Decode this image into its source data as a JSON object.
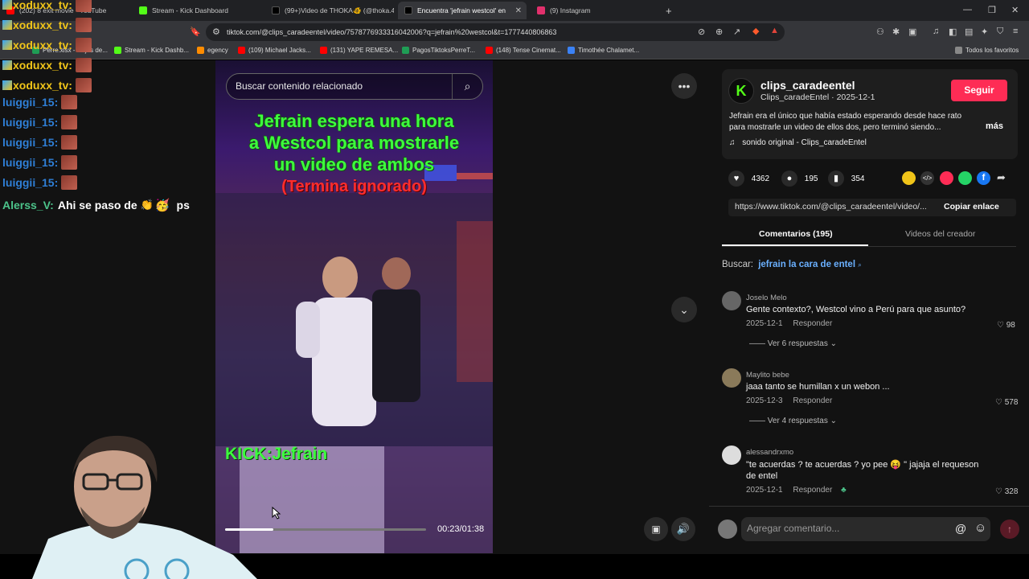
{
  "tabs": [
    {
      "label": "(202) 8 exit movie - YouTube",
      "color": "#ff0000"
    },
    {
      "label": "Stream - Kick Dashboard",
      "color": "#53fc18"
    },
    {
      "label": "(99+)Video de THOKA🐠 (@thoka.4",
      "color": "#111111"
    },
    {
      "label": "Encuentra 'jefrain westcol' en",
      "color": "#111111"
    },
    {
      "label": "(9) Instagram",
      "color": "#e1306c"
    }
  ],
  "new_tab": "+",
  "address": {
    "url": "tiktok.com/@clips_caradeentel/video/7578776933316042006?q=jefrain%20westcol&t=1777440806863"
  },
  "bookmarks": [
    {
      "label": "Perre.xlsx - Hojas de...",
      "color": "#1f9d55"
    },
    {
      "label": "Stream - Kick Dashb...",
      "color": "#53fc18"
    },
    {
      "label": "egency",
      "color": "#ff8c00"
    },
    {
      "label": "(109) Michael Jacks...",
      "color": "#ff0000"
    },
    {
      "label": "(131) YAPE REMESA...",
      "color": "#ff0000"
    },
    {
      "label": "PagosTiktoksPerreT...",
      "color": "#1f9d55"
    },
    {
      "label": "(148) Tense Cinemat...",
      "color": "#ff0000"
    },
    {
      "label": "Timothée Chalamet...",
      "color": "#3b82f6"
    },
    {
      "label": "Todos los favoritos",
      "color": "#888888"
    }
  ],
  "chat": [
    {
      "user": "xoduxx_tv:",
      "color": "#f0c419"
    },
    {
      "user": "xoduxx_tv:",
      "color": "#f0c419"
    },
    {
      "user": "xoduxx_tv:",
      "color": "#f0c419"
    },
    {
      "user": "xoduxx_tv:",
      "color": "#f0c419"
    },
    {
      "user": "xoduxx_tv:",
      "color": "#f0c419"
    },
    {
      "user": "luiggii_15:",
      "color": "#2f7fd6"
    },
    {
      "user": "luiggii_15:",
      "color": "#2f7fd6"
    },
    {
      "user": "luiggii_15:",
      "color": "#2f7fd6"
    },
    {
      "user": "luiggii_15:",
      "color": "#2f7fd6"
    },
    {
      "user": "luiggii_15:",
      "color": "#2f7fd6"
    }
  ],
  "chat_last": {
    "user": "Alerss_V:",
    "message": "Ahi se paso de",
    "suffix": "ps",
    "color": "#4cc38a"
  },
  "video": {
    "search_placeholder": "Buscar contenido relacionado",
    "caption_lines": [
      "Jefrain espera una hora",
      "a Westcol para mostrarle",
      "un video de ambos"
    ],
    "caption_red": "(Termina ignorado)",
    "watermark": "KICK:Jefrain",
    "time": "00:23/01:38",
    "progress": 0.24
  },
  "creator": {
    "name": "clips_caradeentel",
    "handle": "Clips_caradeEntel",
    "date": "2025-12-1",
    "follow": "Seguir",
    "description": "Jefrain era el único que había estado esperando desde hace rato para mostrarle un video de ellos dos, pero terminó siendo...",
    "more": "más",
    "sound": "sonido original - Clips_caradeEntel",
    "likes": "4362",
    "comments": "195",
    "saves": "354",
    "link": "https://www.tiktok.com/@clips_caradeentel/video/...",
    "copy": "Copiar enlace"
  },
  "tabs_panel": {
    "comments": "Comentarios (195)",
    "creator_videos": "Videos del creador"
  },
  "search_hint": {
    "label": "Buscar:",
    "query": "jefrain la cara de entel"
  },
  "comments": [
    {
      "name": "Joselo Melo",
      "text": "Gente contexto?, Westcol vino a Perú para que asunto?",
      "date": "2025-12-1",
      "reply": "Responder",
      "likes": "98",
      "more": "Ver 6 respuestas"
    },
    {
      "name": "Maylito bebe",
      "text": "jaaa tanto se humillan x un webon ...",
      "date": "2025-12-3",
      "reply": "Responder",
      "likes": "578",
      "more": "Ver 4 respuestas"
    },
    {
      "name": "alessandrxmo",
      "text": "\"te acuerdas ? te acuerdas ? yo pee 😝 \" jajaja el requeson",
      "text2": "de entel",
      "date": "2025-12-1",
      "reply": "Responder",
      "likes": "328"
    }
  ],
  "add_comment": "Agregar comentario...",
  "accent": "#fe2c55"
}
